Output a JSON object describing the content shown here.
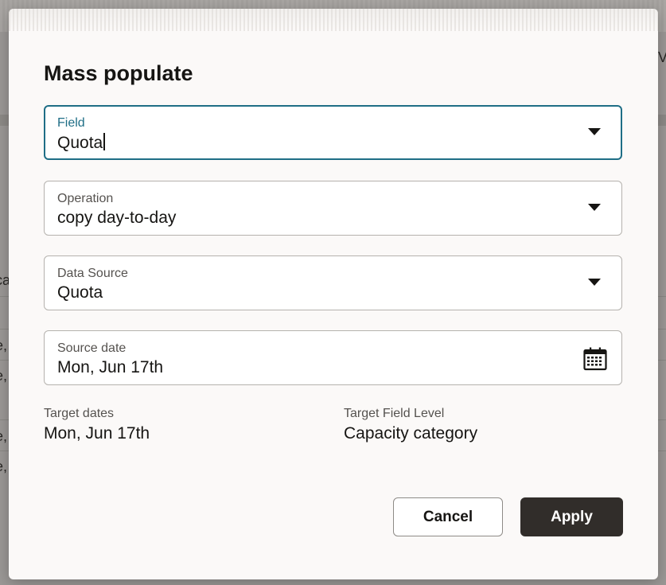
{
  "dialog": {
    "title": "Mass populate",
    "field": {
      "label": "Field",
      "value": "Quota"
    },
    "operation": {
      "label": "Operation",
      "value": "copy day-to-day"
    },
    "data_source": {
      "label": "Data Source",
      "value": "Quota"
    },
    "source_date": {
      "label": "Source date",
      "value": "Mon, Jun 17th"
    },
    "target_dates": {
      "label": "Target dates",
      "value": "Mon, Jun 17th"
    },
    "target_field_level": {
      "label": "Target Field Level",
      "value": "Capacity category"
    },
    "buttons": {
      "cancel": "Cancel",
      "apply": "Apply"
    }
  },
  "background": {
    "fragments": [
      "Vi",
      "ca",
      "e,",
      "e,",
      "e,",
      "e,"
    ]
  },
  "icons": {
    "dropdown": "chevron-down-icon",
    "calendar": "calendar-icon"
  },
  "colors": {
    "focus_border": "#1f6e86",
    "primary_button": "#312d2a",
    "dialog_background": "#fbf9f8",
    "text": "#161513",
    "label": "#55524f"
  }
}
